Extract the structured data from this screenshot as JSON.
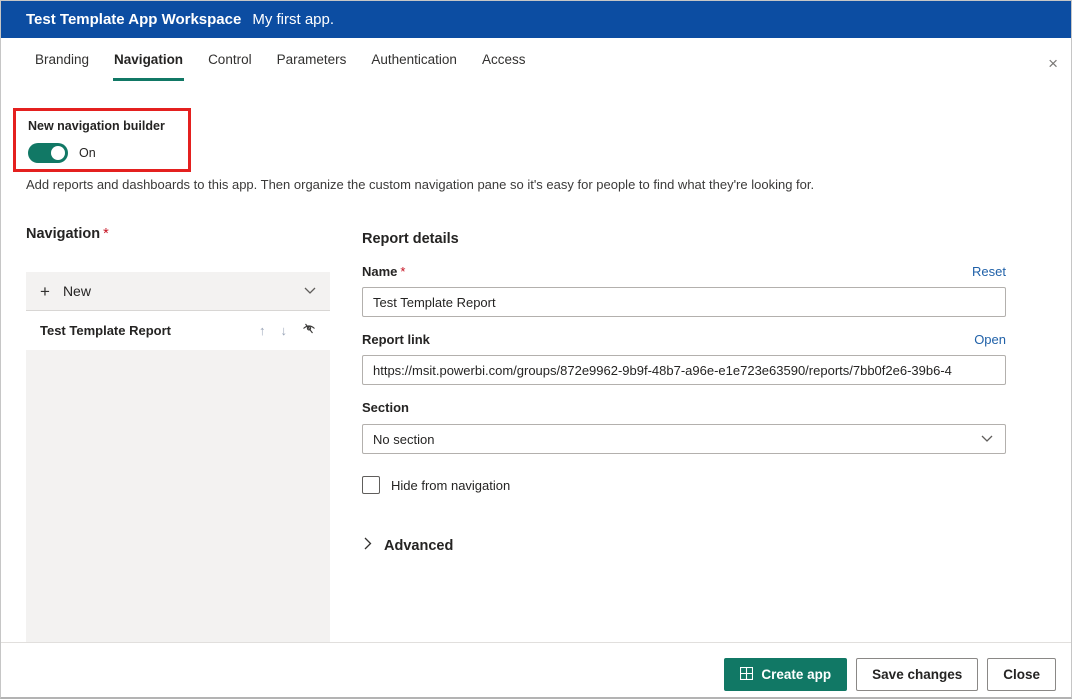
{
  "header": {
    "title": "Test Template App Workspace",
    "subtitle": "My first app."
  },
  "tabs": {
    "items": [
      {
        "label": "Branding",
        "active": false
      },
      {
        "label": "Navigation",
        "active": true
      },
      {
        "label": "Control",
        "active": false
      },
      {
        "label": "Parameters",
        "active": false
      },
      {
        "label": "Authentication",
        "active": false
      },
      {
        "label": "Access",
        "active": false
      }
    ],
    "close_glyph": "×"
  },
  "toggle_section": {
    "label": "New navigation builder",
    "state": "On",
    "enabled": true
  },
  "description": "Add reports and dashboards to this app. Then organize the custom navigation pane so it's easy for people to find what they're looking for.",
  "navigation_panel": {
    "heading": "Navigation",
    "required_mark": "*",
    "new_button": {
      "plus_glyph": "+",
      "label": "New"
    },
    "items": [
      {
        "label": "Test Template Report"
      }
    ]
  },
  "icons": {
    "up_arrow": "↑",
    "down_arrow": "↓"
  },
  "report_details": {
    "heading": "Report details",
    "name_field": {
      "label": "Name",
      "required_mark": "*",
      "action_link": "Reset",
      "value": "Test Template Report"
    },
    "link_field": {
      "label": "Report link",
      "action_link": "Open",
      "value": "https://msit.powerbi.com/groups/872e9962-9b9f-48b7-a96e-e1e723e63590/reports/7bb0f2e6-39b6-4"
    },
    "section_field": {
      "label": "Section",
      "value": "No section"
    },
    "hide_checkbox": {
      "label": "Hide from navigation",
      "checked": false
    },
    "advanced": {
      "label": "Advanced"
    }
  },
  "footer": {
    "create_button": "Create app",
    "save_button": "Save changes",
    "close_button": "Close"
  },
  "colors": {
    "header_bg": "#0c4da2",
    "accent": "#117865",
    "highlight_red": "#e4201f",
    "link": "#2061a8",
    "panel_gray": "#f3f2f1"
  }
}
